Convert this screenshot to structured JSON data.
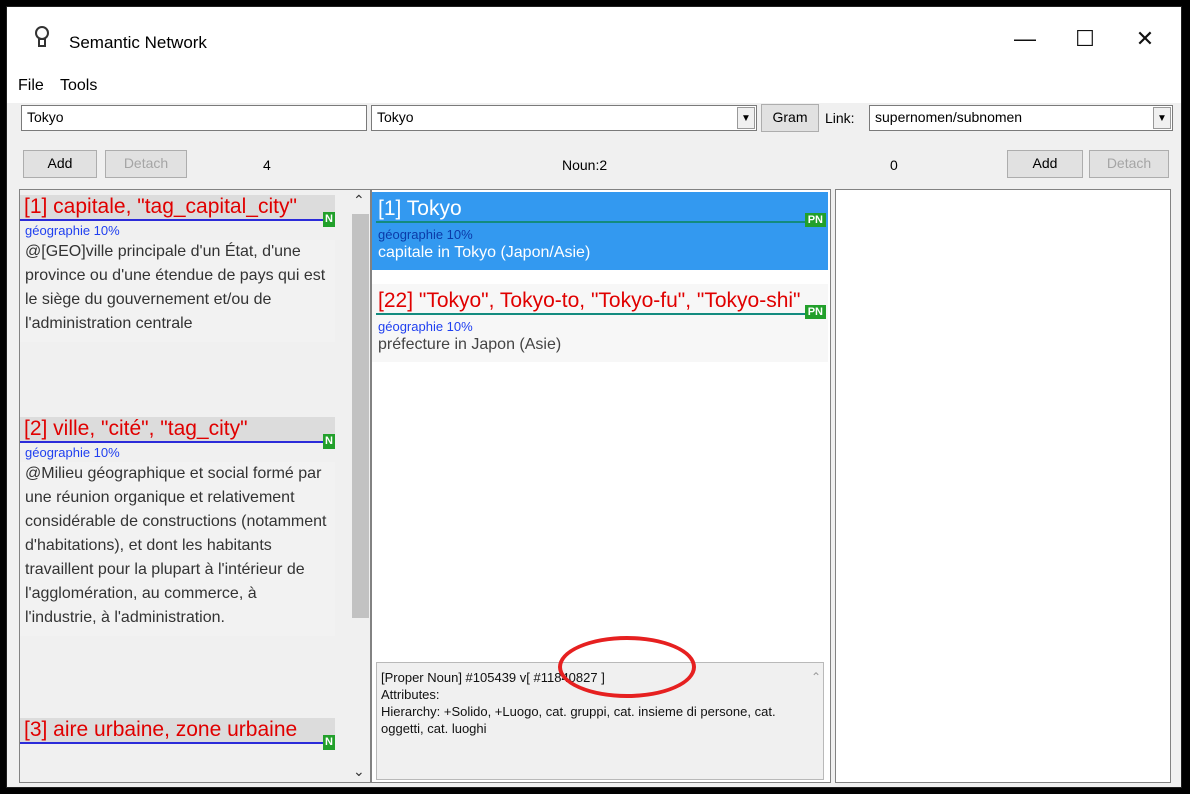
{
  "app": {
    "title": "Semantic Network"
  },
  "window_controls": {
    "minimize": "—",
    "maximize": "☐",
    "close": "✕"
  },
  "menu": {
    "file": "File",
    "tools": "Tools"
  },
  "toolbar": {
    "search_value": "Tokyo",
    "lemma_value": "Tokyo",
    "gram_button": "Gram",
    "link_label": "Link:",
    "link_value": "supernomen/subnomen"
  },
  "left": {
    "add_button": "Add",
    "detach_button": "Detach",
    "count": "4",
    "entries": [
      {
        "head": "[1] capitale, \"tag_capital_city\"",
        "domain": "géographie 10%",
        "definition": "@[GEO]ville principale d'un État, d'une province ou d'une étendue de pays qui est le siège du gouvernement et/ou de l'administration centrale"
      },
      {
        "head": "[2] ville, \"cité\", \"tag_city\"",
        "domain": "géographie 10%",
        "definition": "@Milieu géographique et social formé par une réunion organique et relativement considérable de constructions (notamment d'habitations), et dont les habitants travaillent pour la plupart à l'intérieur de l'agglomération, au commerce, à l'industrie, à l'administration."
      },
      {
        "head": "[3] aire urbaine, zone urbaine",
        "domain": "",
        "definition": ""
      }
    ],
    "n_tag": "N"
  },
  "center": {
    "header": "Noun:2",
    "pn_tag": "PN",
    "senses": [
      {
        "title": "[1] Tokyo",
        "domain": "géographie 10%",
        "definition": "capitale in Tokyo (Japon/Asie)"
      },
      {
        "title": "[22] \"Tokyo\", Tokyo-to, \"Tokyo-fu\", \"Tokyo-shi\"",
        "domain": "géographie 10%",
        "definition": "préfecture in Japon (Asie)"
      }
    ],
    "info": {
      "line1": "[Proper Noun] #105439 v[ #11840827 ]",
      "line2": "Attributes:",
      "line3": "Hierarchy: +Solido, +Luogo, cat. gruppi, cat. insieme di persone, cat. oggetti, cat. luoghi"
    }
  },
  "right": {
    "count": "0",
    "add_button": "Add",
    "detach_button": "Detach"
  },
  "colors": {
    "selected": "#3399f0",
    "head_red": "#e00000",
    "domain_blue": "#1f3ff0",
    "tag_green": "#22a02b"
  }
}
